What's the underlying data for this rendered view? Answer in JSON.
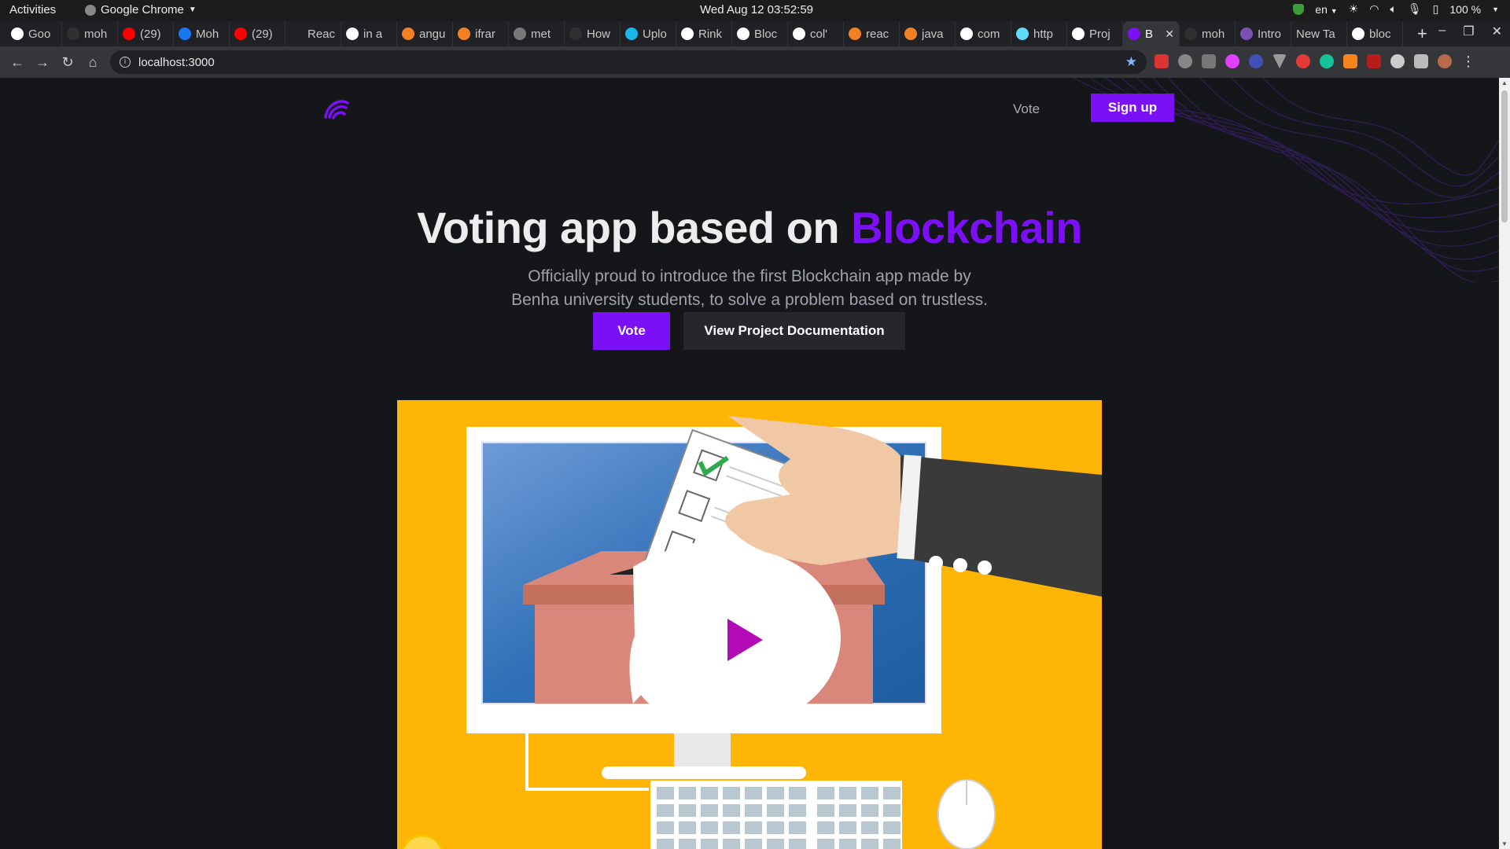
{
  "system": {
    "activities": "Activities",
    "app": "Google Chrome",
    "clock": "Wed Aug 12  03:52:59",
    "lang": "en",
    "battery": "100 %"
  },
  "tabs": [
    {
      "label": "Goo",
      "icon": "google-icon",
      "color": "#ffffff"
    },
    {
      "label": "moh",
      "icon": "github-icon",
      "color": "#303030"
    },
    {
      "label": "(29)",
      "icon": "youtube-icon",
      "color": "#ff0000"
    },
    {
      "label": "Moh",
      "icon": "facebook-icon",
      "color": "#1877f2"
    },
    {
      "label": "(29)",
      "icon": "youtube-icon",
      "color": "#ff0000"
    },
    {
      "label": "Reac",
      "icon": "mdn-icon",
      "color": "#202124"
    },
    {
      "label": "in a",
      "icon": "google-icon",
      "color": "#ffffff"
    },
    {
      "label": "angu",
      "icon": "stackoverflow-icon",
      "color": "#f48024"
    },
    {
      "label": "ifrar",
      "icon": "stackoverflow-icon",
      "color": "#f48024"
    },
    {
      "label": "met",
      "icon": "globe-icon",
      "color": "#777777"
    },
    {
      "label": "How",
      "icon": "github-icon",
      "color": "#303030"
    },
    {
      "label": "Uplo",
      "icon": "vimeo-icon",
      "color": "#1ab7ea"
    },
    {
      "label": "Rink",
      "icon": "globe-icon",
      "color": "#ffffff"
    },
    {
      "label": "Bloc",
      "icon": "globe-icon",
      "color": "#ffffff"
    },
    {
      "label": "col'",
      "icon": "google-icon",
      "color": "#ffffff"
    },
    {
      "label": "reac",
      "icon": "stackoverflow-icon",
      "color": "#f48024"
    },
    {
      "label": "java",
      "icon": "stackoverflow-icon",
      "color": "#f48024"
    },
    {
      "label": "com",
      "icon": "google-icon",
      "color": "#ffffff"
    },
    {
      "label": "http",
      "icon": "react-icon",
      "color": "#61dafb"
    },
    {
      "label": "Proj",
      "icon": "globe-icon",
      "color": "#ffffff"
    },
    {
      "label": "B",
      "icon": "app-logo-icon",
      "color": "#7b0ff5",
      "active": true
    },
    {
      "label": "moh",
      "icon": "github-icon",
      "color": "#303030"
    },
    {
      "label": "Intro",
      "icon": "bootstrap-icon",
      "color": "#7952b3"
    },
    {
      "label": "New Ta",
      "icon": "",
      "color": ""
    },
    {
      "label": "bloc",
      "icon": "google-icon",
      "color": "#ffffff"
    }
  ],
  "address": {
    "url": "localhost:3000"
  },
  "site": {
    "nav_vote": "Vote",
    "signup": "Sign up",
    "title_main": "Voting app based on ",
    "title_accent": "Blockchain",
    "subtitle_line1": "Officially proud to introduce the first Blockchain app made by",
    "subtitle_line2": "Benha university students, to solve a problem based on trustless.",
    "btn_vote": "Vote",
    "btn_docs": "View Project Documentation",
    "accent_color": "#7b0ff5",
    "video_bg": "#ffb505"
  }
}
